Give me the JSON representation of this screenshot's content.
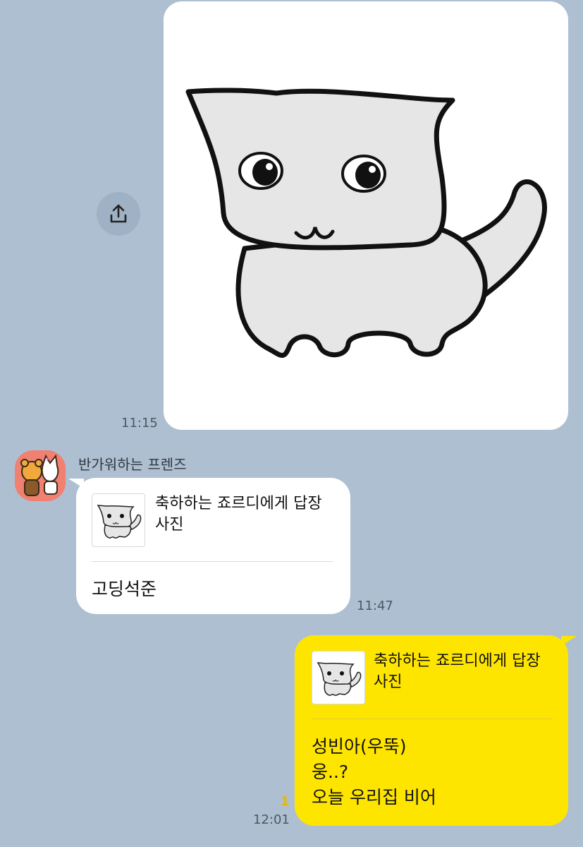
{
  "chat": {
    "photo_message": {
      "time": "11:15"
    },
    "incoming": {
      "sender": "반가워하는 프렌즈",
      "reply_title_line1": "축하하는 죠르디에게 답장",
      "reply_title_line2": "사진",
      "text": "고딩석준",
      "time": "11:47"
    },
    "outgoing": {
      "reply_title_line1": "축하하는 죠르디에게 답장",
      "reply_title_line2": "사진",
      "lines": [
        "성빈아(우뚝)",
        "웅..?",
        "오늘 우리집 비어"
      ],
      "unread_count": "1",
      "time": "12:01"
    }
  },
  "colors": {
    "background": "#aebfd2",
    "outgoing_bubble": "#fee500",
    "incoming_bubble": "#ffffff",
    "unread": "#e6b800"
  },
  "icons": {
    "share": "share-upload-icon"
  }
}
